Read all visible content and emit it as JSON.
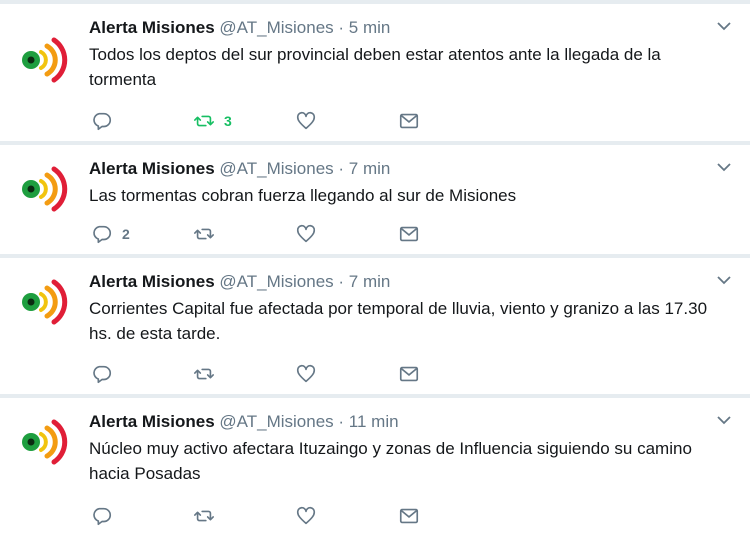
{
  "colors": {
    "retweet_active": "#17bf63",
    "icon": "#657786",
    "name": "#14171a"
  },
  "icons": {
    "reply": "reply-icon",
    "retweet": "retweet-icon",
    "like": "heart-icon",
    "dm": "envelope-icon",
    "menu": "chevron-down-icon"
  },
  "tweets": [
    {
      "name": "Alerta Misiones",
      "handle": "@AT_Misiones",
      "dot": "·",
      "time": "5 min",
      "text": "Todos los deptos del sur provincial deben estar atentos ante la llegada de la tormenta",
      "reply_count": "",
      "retweet_count": "3",
      "retweeted": true
    },
    {
      "name": "Alerta Misiones",
      "handle": "@AT_Misiones",
      "dot": "·",
      "time": "7 min",
      "text": "Las tormentas cobran fuerza llegando al sur de Misiones",
      "reply_count": "2",
      "retweet_count": "",
      "retweeted": false
    },
    {
      "name": "Alerta Misiones",
      "handle": "@AT_Misiones",
      "dot": "·",
      "time": "7 min",
      "text": "Corrientes Capital fue afectada por temporal de lluvia, viento y granizo a las 17.30 hs. de esta tarde.",
      "reply_count": "",
      "retweet_count": "",
      "retweeted": false
    },
    {
      "name": "Alerta Misiones",
      "handle": "@AT_Misiones",
      "dot": "·",
      "time": "11 min",
      "text": "Núcleo muy activo afectara Ituzaingo y zonas de Influencia siguiendo su camino hacia Posadas",
      "reply_count": "",
      "retweet_count": "",
      "retweeted": false
    }
  ]
}
